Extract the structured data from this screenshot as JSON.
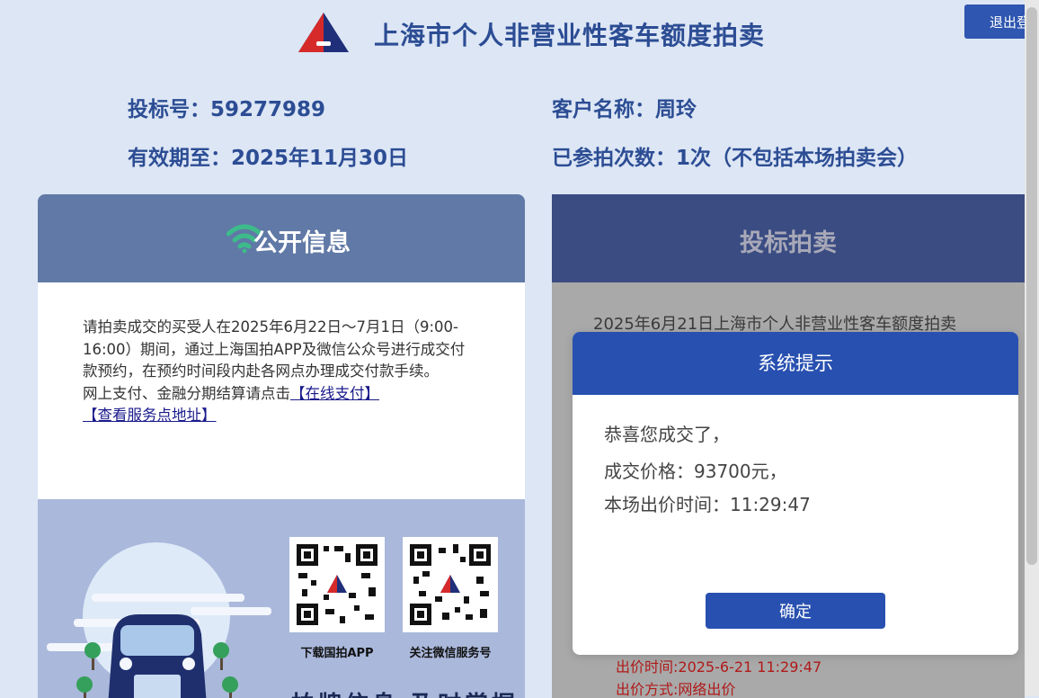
{
  "header": {
    "title": "上海市个人非营业性客车额度拍卖",
    "logout_label": "退出登录"
  },
  "info": {
    "bid_no_label": "投标号：",
    "bid_no_value": "59277989",
    "customer_label": "客户名称：",
    "customer_value": "周玲",
    "valid_label": "有效期至：",
    "valid_value": "2025年11月30日",
    "count_label": "已参拍次数：",
    "count_value": "1次（不包括本场拍卖会）"
  },
  "left_panel": {
    "title": "公开信息",
    "notice_1": "请拍卖成交的买受人在2025年6月22日～7月1日（9:00-16:00）期间，通过上海国拍APP及微信公众号进行成交付款预约，在预约时间段内赴各网点办理成交付款手续。",
    "notice_2": "网上支付、金融分期结算请点击",
    "link_pay": "【在线支付】",
    "link_address": "【查看服务点地址】",
    "qr_app_caption": "下载国拍APP",
    "qr_wechat_caption": "关注微信服务号",
    "promo_text": "拍牌信息 及时掌握"
  },
  "right_panel": {
    "title": "投标拍卖",
    "auction_line": "2025年6月21日上海市个人非营业性客车额度拍卖",
    "bid_time": "出价时间:2025-6-21 11:29:47",
    "bid_method": "出价方式:网络出价"
  },
  "modal": {
    "title": "系统提示",
    "line_1": "恭喜您成交了，",
    "line_2": "成交价格：93700元，",
    "line_3": "本场出价时间：11:29:47",
    "ok_label": "确定"
  },
  "colors": {
    "page_bg": "#dde6f5",
    "brand_blue": "#2850b0",
    "left_head": "#6079a6",
    "right_head": "#3a4c82",
    "wifi_green": "#3dbb8a",
    "alert_red": "#b01a1a"
  }
}
